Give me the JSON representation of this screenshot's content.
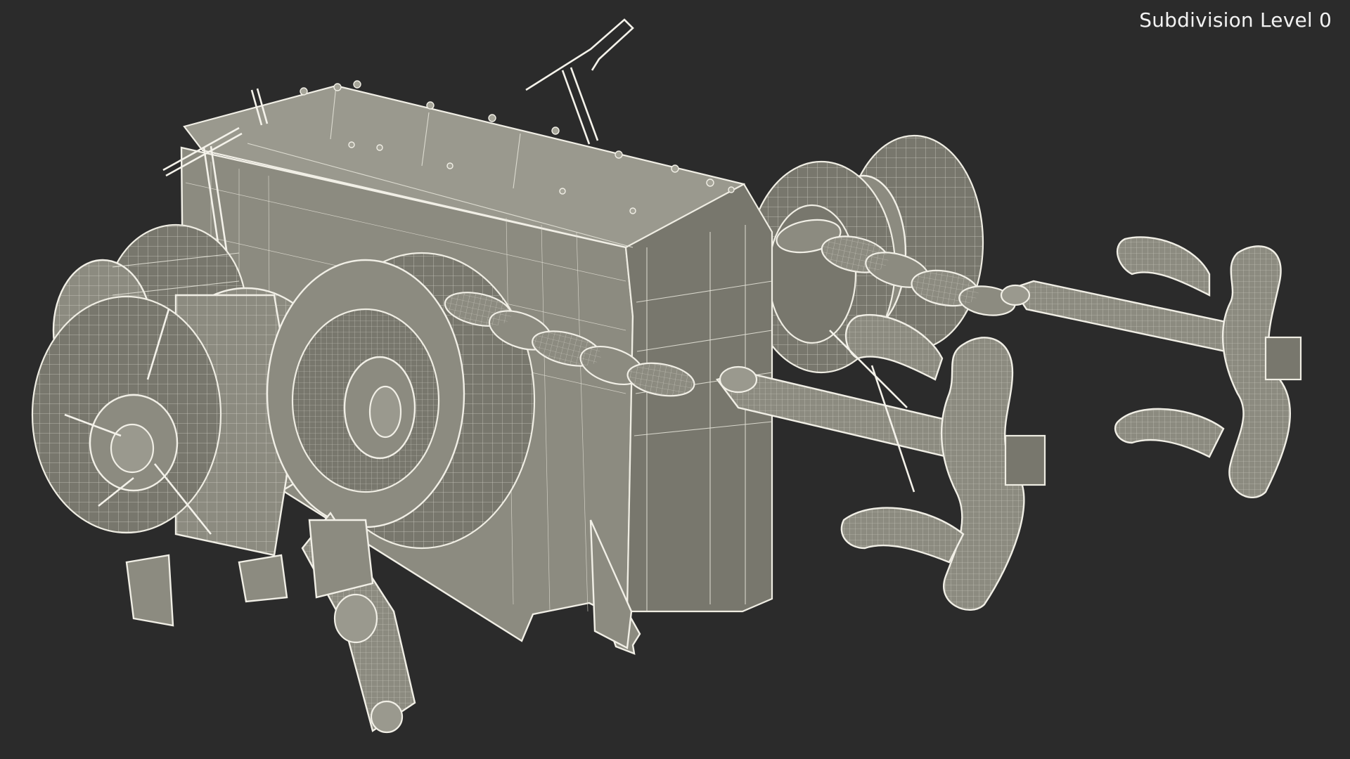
{
  "viewport": {
    "overlay_label": "Subdivision Level 0",
    "background": "#2b2b2b",
    "model_fill": "#8c8b80",
    "wire_color": "#f1efe6"
  }
}
